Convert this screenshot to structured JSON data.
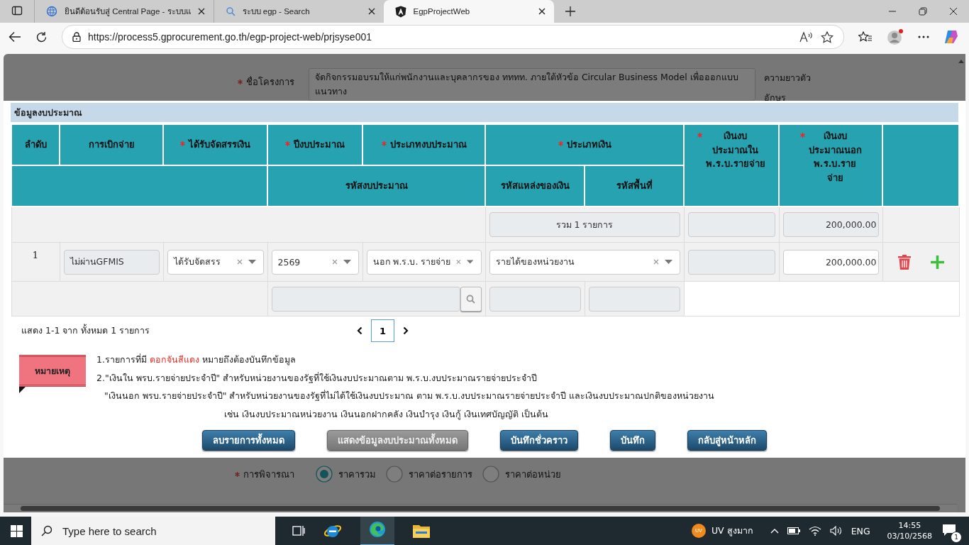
{
  "browser": {
    "tabs": [
      {
        "title": "ยินดีต้อนรับสู่ Central Page - ระบบแ",
        "selected": false
      },
      {
        "title": "ระบบ egp - Search",
        "selected": false
      },
      {
        "title": "EgpProjectWeb",
        "selected": true
      }
    ],
    "url": "https://process5.gprocurement.go.th/egp-project-web/prjsyse001"
  },
  "background_form": {
    "project_name": {
      "label": "ชื่อโครงการ",
      "required": true,
      "value": "จัดกิจกรรมอบรมให้แก่พนักงานและบุคลากรของ ทททท. ภายใต้หัวข้อ Circular Business Model เพื่อออกแบบแนวทาง",
      "hint_lines": [
        "ความยาวตัว",
        "อักษร"
      ]
    },
    "consideration": {
      "label": "การพิจารณา",
      "required": true,
      "options": [
        {
          "label": "ราคารวม",
          "selected": true
        },
        {
          "label": "ราคาต่อรายการ",
          "selected": false
        },
        {
          "label": "ราคาต่อหน่วย",
          "selected": false
        }
      ]
    }
  },
  "modal": {
    "title": "ข้อมูลงบประมาณ",
    "header_top": [
      {
        "lines": [
          "ลำดับ"
        ],
        "required": false
      },
      {
        "lines": [
          "การเบิกจ่าย"
        ],
        "required": false
      },
      {
        "lines": [
          "ได้รับจัดสรรเงิน"
        ],
        "required": true
      },
      {
        "lines": [
          "ปีงบประมาณ"
        ],
        "required": true
      },
      {
        "lines": [
          "ประเภทงบประมาณ"
        ],
        "required": true
      },
      {
        "lines": [
          "ประเภทเงิน"
        ],
        "required": true
      },
      {
        "lines": [
          "เงินงบ",
          "ประมาณใน",
          "พ.ร.บ.รายจ่าย"
        ],
        "required": true
      },
      {
        "lines": [
          "เงินงบ",
          "ประมาณนอก",
          "พ.ร.บ.ราย",
          "จ่าย"
        ],
        "required": true
      }
    ],
    "header_sub": [
      "รหัสงบประมาณ",
      "รหัสแหล่งของเงิน",
      "รหัสพื้นที่"
    ],
    "total_row": {
      "count_label": "รวม 1 รายการ",
      "out_budget": "200,000.00"
    },
    "rows": [
      {
        "no": "1",
        "disbursement": "ไม่ผ่านGFMIS",
        "allocation": "ได้รับจัดสรร",
        "fiscal_year": "2569",
        "budget_type": "นอก พ.ร.บ. รายจ่าย",
        "fund_type": "รายได้ของหน่วยงาน",
        "out_budget": "200,000.00"
      }
    ],
    "pagination": {
      "summary": "แสดง 1-1 จาก ทั้งหมด 1 รายการ",
      "pages": [
        {
          "label": "1",
          "selected": true
        }
      ]
    },
    "notes": {
      "label": "หมายเหตุ",
      "lines": [
        {
          "kind": "item",
          "before": "1.รายการที่มี",
          "highlight": "ดอกจันสีแดง",
          "after": "หมายถึงต้องบันทึกข้อมูล"
        },
        {
          "kind": "item",
          "text": "2.\"เงินใน พรบ.รายจ่ายประจำปี\" สำหรับหน่วยงานของรัฐที่ใช้เงินงบประมาณตาม พ.ร.บ.งบประมาณรายจ่ายประจำปี"
        },
        {
          "kind": "continuation",
          "text": "\"เงินนอก พรบ.รายจ่ายประจำปี\" สำหรับหน่วยงานของรัฐที่ไม่ได้ใช้เงินงบประมาณ ตาม พ.ร.บ.งบประมาณรายจ่ายประจำปี และเงินงบประมาณปกติของหน่วยงาน"
        },
        {
          "kind": "example",
          "text": "เช่น เงินงบประมาณหน่วยงาน เงินนอกฝากคลัง เงินบำรุง เงินกู้ เงินเทศบัญญัติ เป็นต้น"
        }
      ]
    },
    "buttons": [
      {
        "label": "ลบรายการทั้งหมด",
        "disabled": false
      },
      {
        "label": "แสดงข้อมูลงบประมาณทั้งหมด",
        "disabled": true
      },
      {
        "label": "บันทึกชั่วคราว",
        "disabled": false
      },
      {
        "label": "บันทึก",
        "disabled": false
      },
      {
        "label": "กลับสู่หน้าหลัก",
        "disabled": false
      }
    ]
  },
  "taskbar": {
    "search_placeholder": "Type here to search",
    "weather_badge": "UV",
    "weather_text": "UV สูงมาก",
    "language": "ENG",
    "time": "14:55",
    "date": "03/10/2568",
    "notification_count": "1"
  }
}
